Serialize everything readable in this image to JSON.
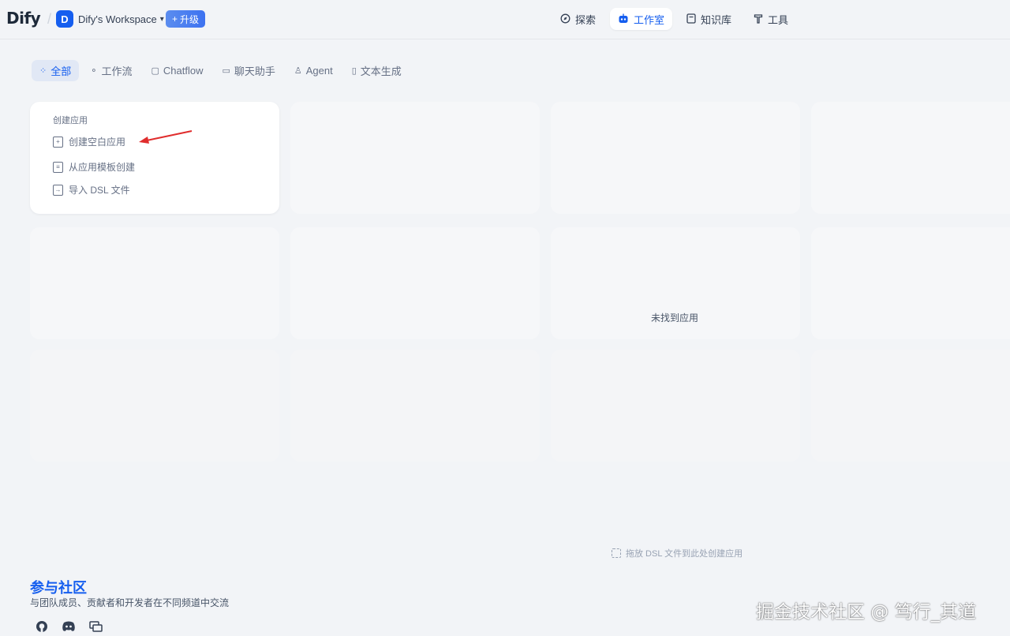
{
  "header": {
    "logo": "Dify",
    "workspace_initial": "D",
    "workspace_name": "Dify's Workspace",
    "upgrade_label": "升级",
    "nav": [
      {
        "label": "探索",
        "icon": "compass-icon",
        "active": false
      },
      {
        "label": "工作室",
        "icon": "robot-icon",
        "active": true
      },
      {
        "label": "知识库",
        "icon": "book-icon",
        "active": false
      },
      {
        "label": "工具",
        "icon": "hammer-icon",
        "active": false
      }
    ]
  },
  "tabs": [
    {
      "label": "全部",
      "icon": "grid-icon",
      "active": true
    },
    {
      "label": "工作流",
      "icon": "workflow-icon",
      "active": false
    },
    {
      "label": "Chatflow",
      "icon": "chatflow-icon",
      "active": false
    },
    {
      "label": "聊天助手",
      "icon": "chat-icon",
      "active": false
    },
    {
      "label": "Agent",
      "icon": "agent-icon",
      "active": false
    },
    {
      "label": "文本生成",
      "icon": "doc-icon",
      "active": false
    }
  ],
  "create_card": {
    "title": "创建应用",
    "items": [
      {
        "label": "创建空白应用",
        "icon": "new-file-icon"
      },
      {
        "label": "从应用模板创建",
        "icon": "template-icon"
      },
      {
        "label": "导入 DSL 文件",
        "icon": "import-icon"
      }
    ]
  },
  "empty_state": "未找到应用",
  "drop_hint": "拖放 DSL 文件到此处创建应用",
  "community": {
    "title": "参与社区",
    "description": "与团队成员、贡献者和开发者在不同频道中交流",
    "links": [
      "github-icon",
      "discord-icon",
      "forum-icon"
    ]
  },
  "watermark": "掘金技术社区 @ 笃行_其道",
  "colors": {
    "accent": "#155eef",
    "background": "#f2f4f7",
    "annotation_arrow": "#e02d2d"
  }
}
